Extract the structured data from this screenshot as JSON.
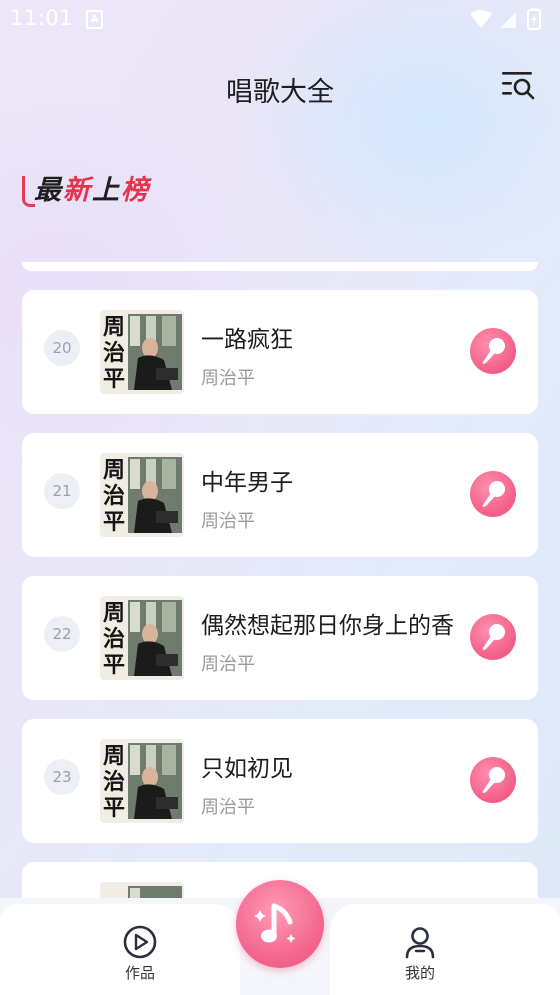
{
  "status_bar": {
    "time": "11:01",
    "notification_badge": "A",
    "icons": [
      "wifi-icon",
      "signal-icon",
      "battery-icon"
    ]
  },
  "header": {
    "title": "唱歌大全",
    "menu_icon": "menu-search-icon"
  },
  "section": {
    "title_chars": [
      "最",
      "新",
      "上",
      "榜"
    ],
    "accent_color": "#e4344e"
  },
  "songs": [
    {
      "rank": "20",
      "title": "一路疯狂",
      "artist": "周治平"
    },
    {
      "rank": "21",
      "title": "中年男子",
      "artist": "周治平"
    },
    {
      "rank": "22",
      "title": "偶然想起那日你身上的香",
      "artist": "周治平"
    },
    {
      "rank": "23",
      "title": "只如初见",
      "artist": "周治平"
    }
  ],
  "cover_text": [
    "周",
    "治",
    "平"
  ],
  "sing_button_icon": "microphone-icon",
  "colors": {
    "accent_pink": "#f35d88",
    "rank_bg": "#eceff6"
  },
  "bottom_nav": {
    "left_label": "作品",
    "left_icon": "play-circle-icon",
    "center_icon": "music-note-icon",
    "right_label": "我的",
    "right_icon": "user-icon"
  }
}
